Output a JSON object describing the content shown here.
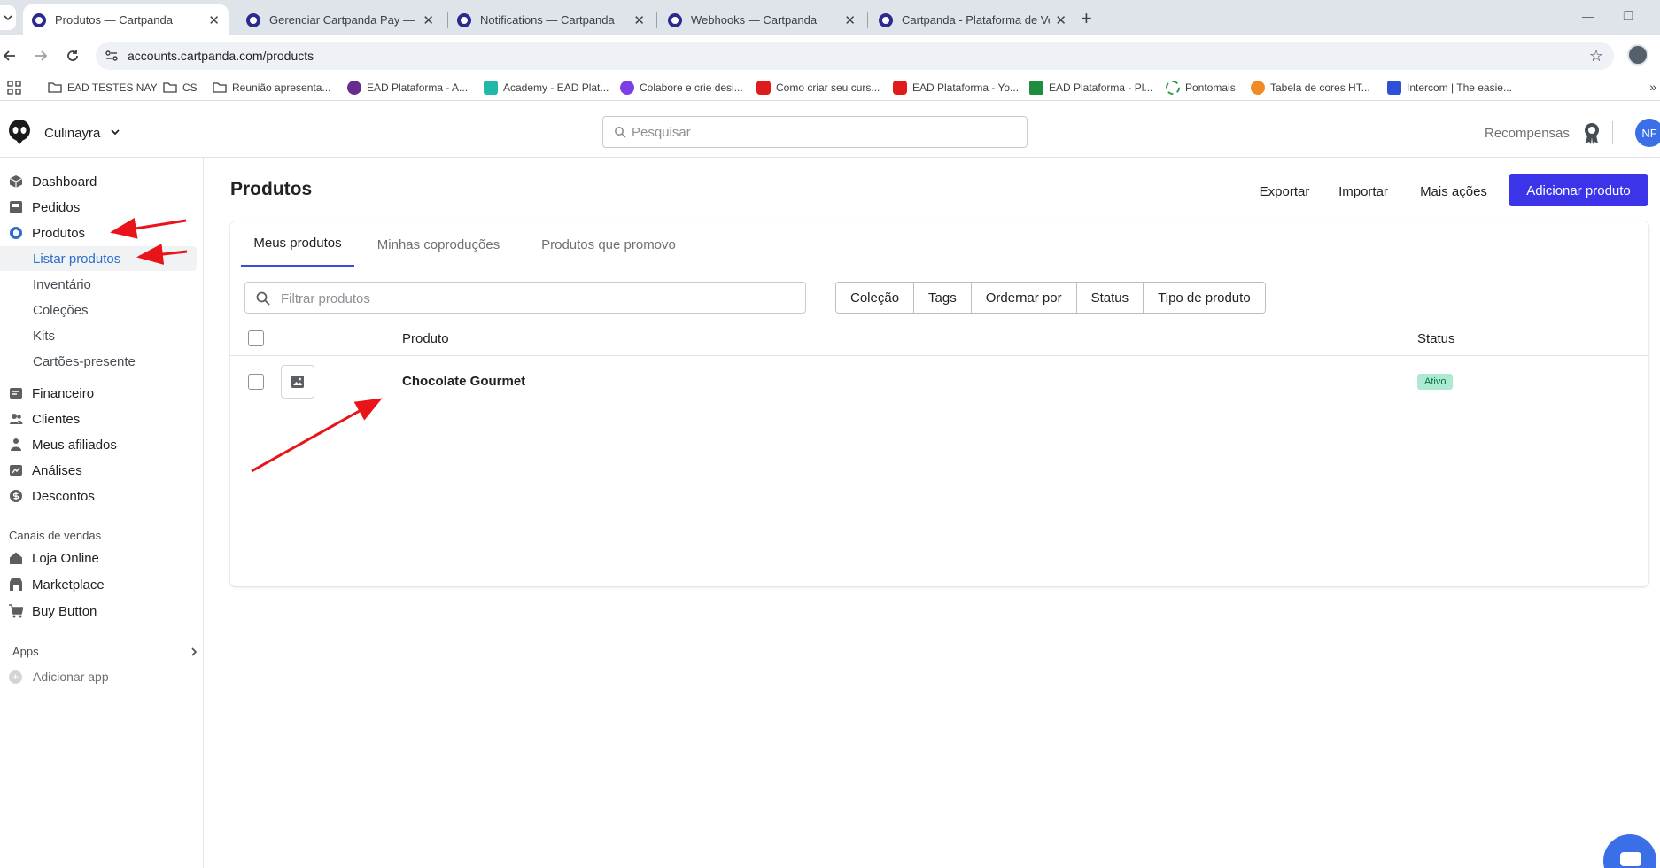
{
  "browser": {
    "tabs": [
      {
        "title": "Produtos — Cartpanda",
        "active": true
      },
      {
        "title": "Gerenciar Cartpanda Pay — Car",
        "active": false
      },
      {
        "title": "Notifications — Cartpanda",
        "active": false
      },
      {
        "title": "Webhooks — Cartpanda",
        "active": false
      },
      {
        "title": "Cartpanda - Plataforma de Venda",
        "active": false
      }
    ],
    "new_tab": "+",
    "url": "accounts.cartpanda.com/products",
    "bookmarks": [
      {
        "label": "EAD TESTES NAY",
        "icon": "folder-icon"
      },
      {
        "label": "CS",
        "icon": "folder-icon"
      },
      {
        "label": "Reunião apresenta...",
        "icon": "folder-icon"
      },
      {
        "label": "EAD Plataforma - A...",
        "icon": "site-icon"
      },
      {
        "label": "Academy - EAD Plat...",
        "icon": "site-icon"
      },
      {
        "label": "Colabore e crie desi...",
        "icon": "site-icon"
      },
      {
        "label": "Como criar seu curs...",
        "icon": "youtube-icon"
      },
      {
        "label": "EAD Plataforma - Yo...",
        "icon": "youtube-icon"
      },
      {
        "label": "EAD Plataforma - Pl...",
        "icon": "sheets-icon"
      },
      {
        "label": "Pontomais",
        "icon": "site-icon"
      },
      {
        "label": "Tabela de cores HT...",
        "icon": "site-icon"
      },
      {
        "label": "Intercom | The easie...",
        "icon": "site-icon"
      }
    ]
  },
  "header": {
    "store_name": "Culinayra",
    "search_placeholder": "Pesquisar",
    "rewards": "Recompensas",
    "avatar_initials": "NF"
  },
  "sidebar": {
    "items": [
      {
        "label": "Dashboard",
        "icon": "cube-icon"
      },
      {
        "label": "Pedidos",
        "icon": "inbox-icon"
      },
      {
        "label": "Produtos",
        "icon": "tag-icon"
      }
    ],
    "sub_items": [
      {
        "label": "Listar produtos",
        "active": true
      },
      {
        "label": "Inventário",
        "active": false
      },
      {
        "label": "Coleções",
        "active": false
      },
      {
        "label": "Kits",
        "active": false
      },
      {
        "label": "Cartões-presente",
        "active": false
      }
    ],
    "items2": [
      {
        "label": "Financeiro",
        "icon": "finance-icon"
      },
      {
        "label": "Clientes",
        "icon": "users-icon"
      },
      {
        "label": "Meus afiliados",
        "icon": "affiliates-icon"
      },
      {
        "label": "Análises",
        "icon": "chart-icon"
      },
      {
        "label": "Descontos",
        "icon": "discount-icon"
      }
    ],
    "channels_title": "Canais de vendas",
    "channels": [
      {
        "label": "Loja Online",
        "icon": "home-icon"
      },
      {
        "label": "Marketplace",
        "icon": "store-icon"
      },
      {
        "label": "Buy Button",
        "icon": "cart-icon"
      }
    ],
    "apps_title": "Apps",
    "add_app": "Adicionar app"
  },
  "main": {
    "title": "Produtos",
    "actions": {
      "export": "Exportar",
      "import": "Importar",
      "more": "Mais ações",
      "add": "Adicionar produto"
    },
    "tabs": [
      "Meus produtos",
      "Minhas coproduções",
      "Produtos que promovo"
    ],
    "filter_placeholder": "Filtrar produtos",
    "filter_buttons": [
      "Coleção",
      "Tags",
      "Ordernar por",
      "Status",
      "Tipo de produto"
    ],
    "columns": {
      "product": "Produto",
      "status": "Status"
    },
    "rows": [
      {
        "name": "Chocolate Gourmet",
        "status": "Ativo"
      }
    ]
  },
  "colors": {
    "primary": "#3b34e8",
    "active_link": "#2c6ecb",
    "badge_bg": "#aee9d1",
    "annotation_arrow": "#e8141a"
  }
}
